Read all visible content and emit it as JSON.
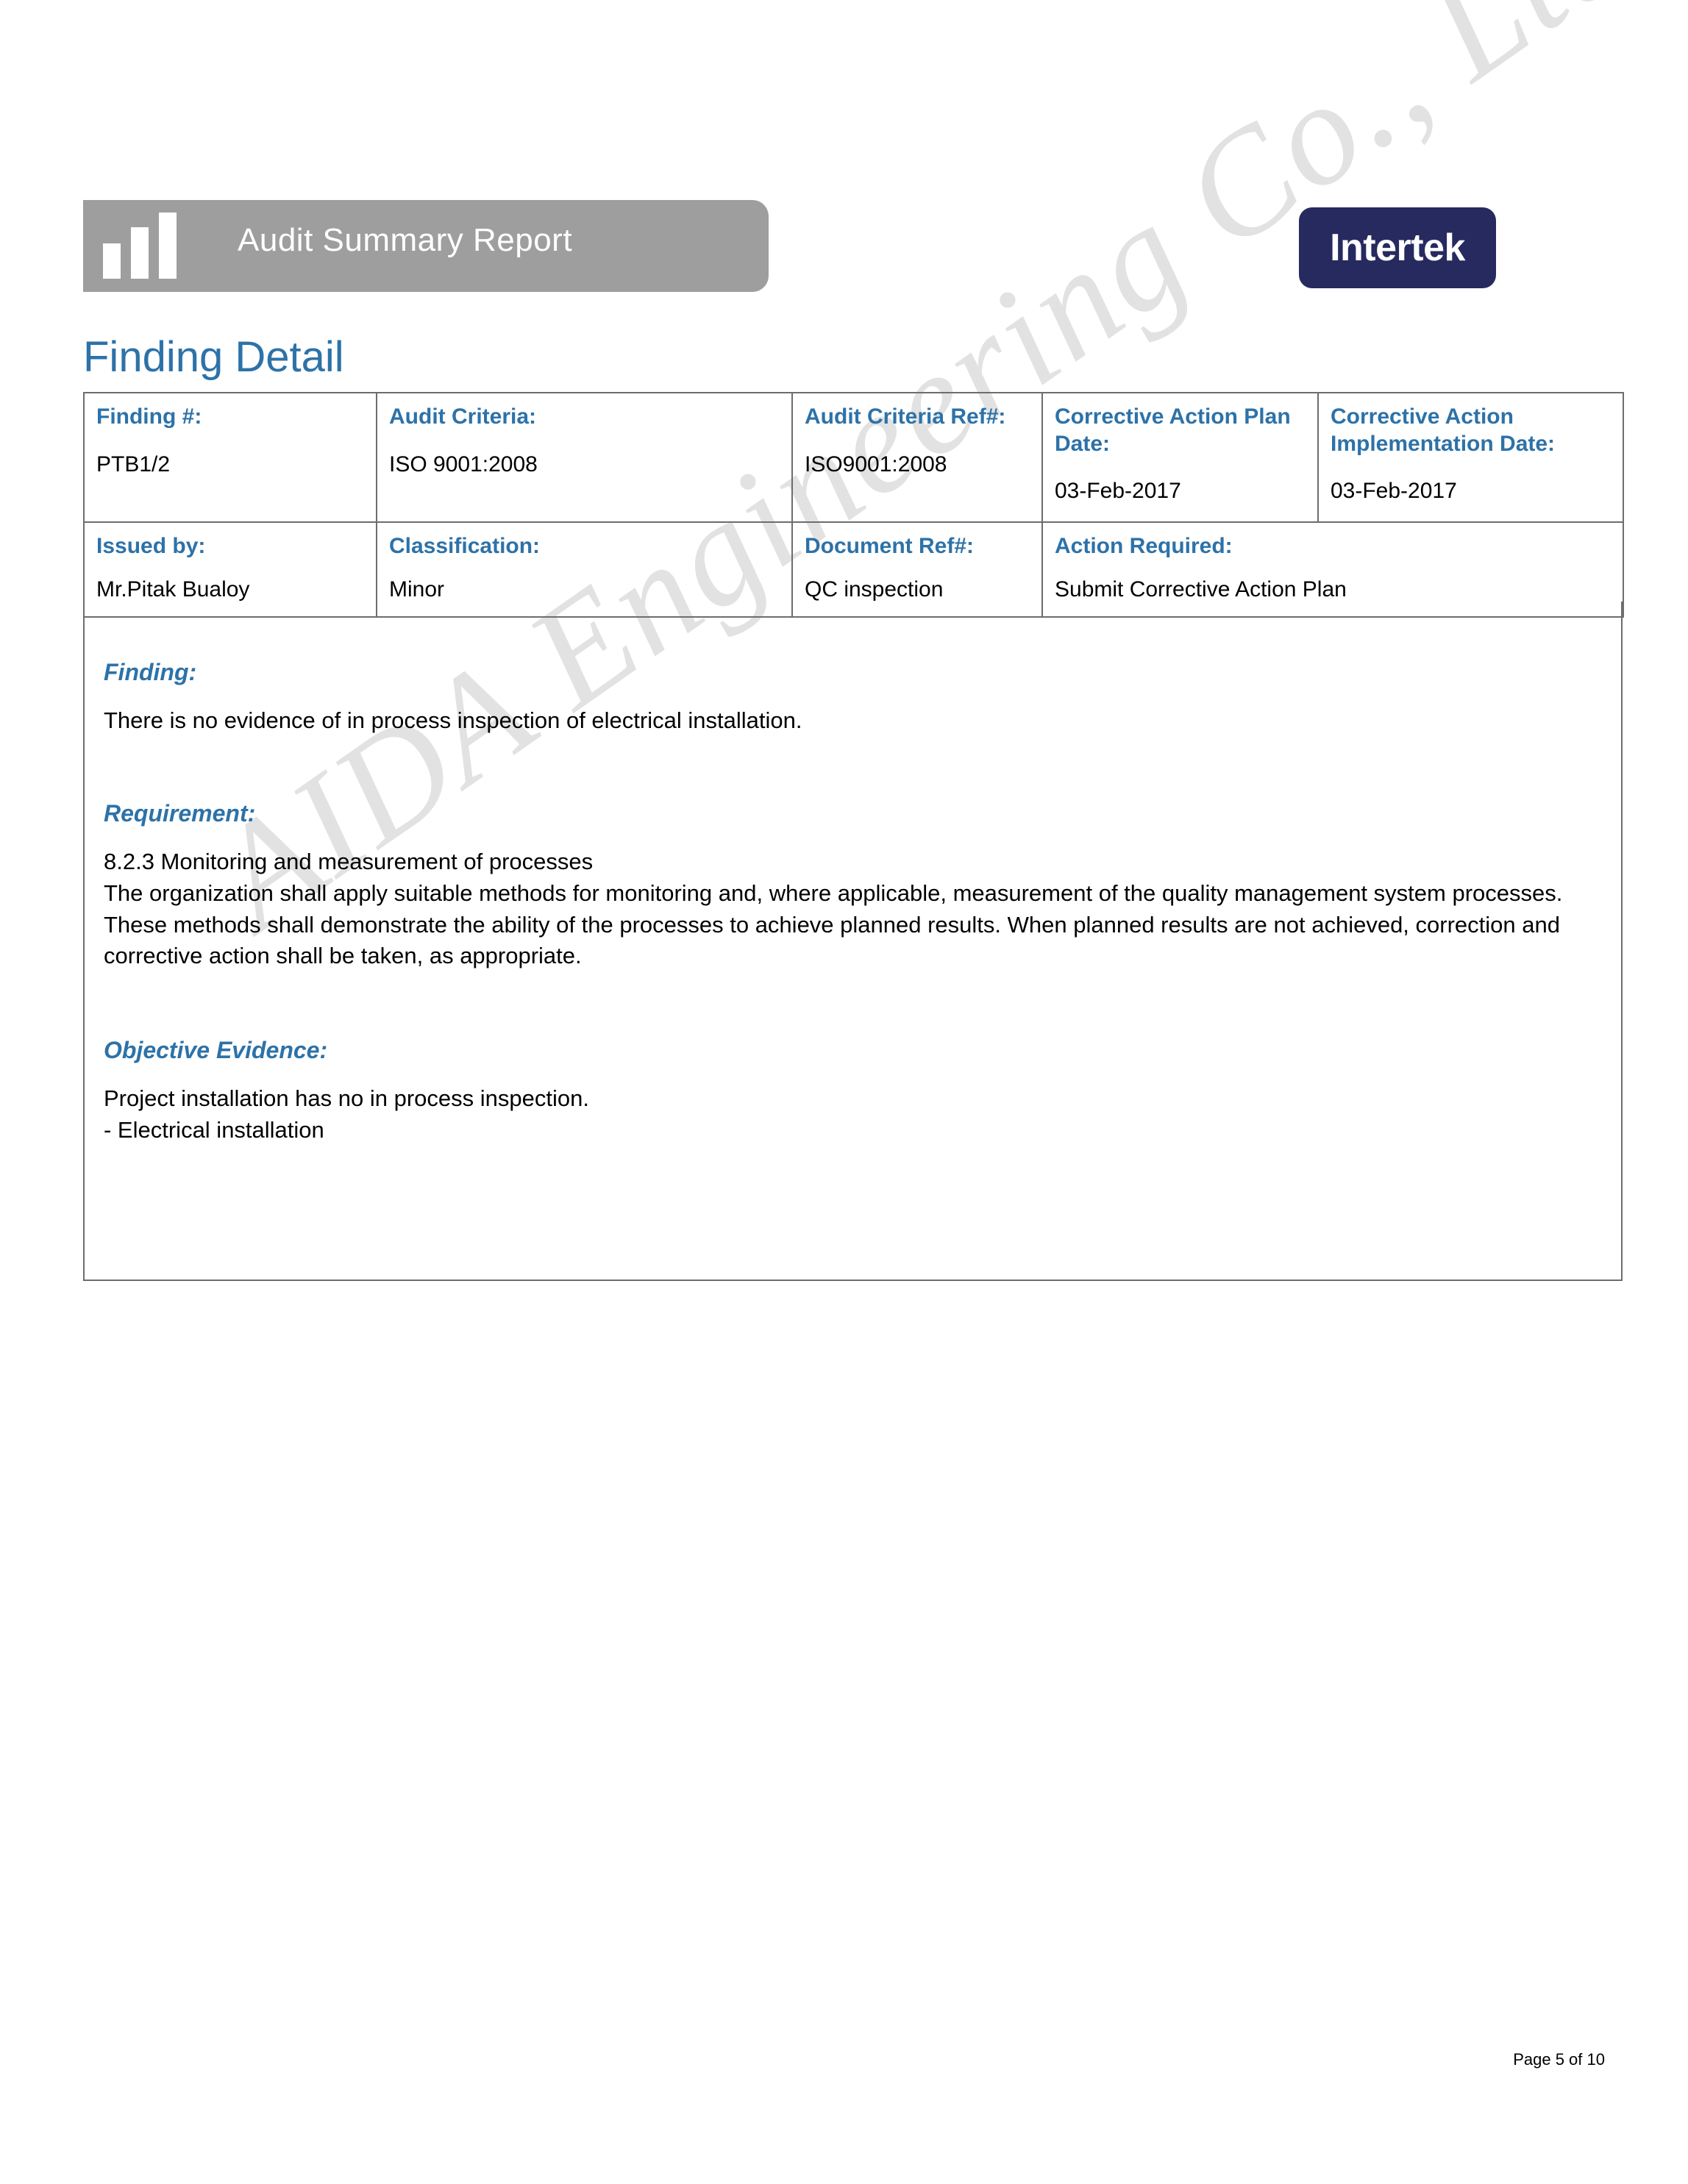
{
  "document": {
    "banner_title": "Audit Summary Report",
    "logo_text": "Intertek",
    "page_heading": "Finding Detail",
    "watermark": "AIDA Engineering Co., Ltd",
    "footer": "Page 5 of 10"
  },
  "colors": {
    "heading_blue": "#2d72a8",
    "banner_gray": "#9e9e9e",
    "logo_navy": "#262a5e",
    "border_gray": "#6d6d6d",
    "watermark_gray": "#e2e2e2"
  },
  "table": {
    "row1": [
      {
        "label": "Finding #:",
        "value": "PTB1/2"
      },
      {
        "label": "Audit Criteria:",
        "value": "ISO 9001:2008"
      },
      {
        "label": "Audit Criteria Ref#:",
        "value": "ISO9001:2008"
      },
      {
        "label": "Corrective Action Plan Date:",
        "value": "03-Feb-2017"
      },
      {
        "label": "Corrective Action Implementation Date:",
        "value": "03-Feb-2017"
      }
    ],
    "row2": [
      {
        "label": "Issued by:",
        "value": "Mr.Pitak Bualoy"
      },
      {
        "label": "Classification:",
        "value": "Minor"
      },
      {
        "label": "Document Ref#:",
        "value": "QC inspection"
      },
      {
        "label": "Action Required:",
        "value": "Submit Corrective Action Plan"
      }
    ]
  },
  "sections": {
    "finding": {
      "title": "Finding:",
      "body": "There is no evidence of in process inspection of electrical installation."
    },
    "requirement": {
      "title": "Requirement:",
      "body": "8.2.3 Monitoring and measurement of processes\nThe organization shall apply suitable methods for monitoring and, where applicable, measurement of the quality management system processes. These methods shall demonstrate the ability of the processes to achieve planned results. When planned results are not achieved, correction and corrective action shall be taken, as appropriate."
    },
    "objective_evidence": {
      "title": "Objective Evidence:",
      "body": "Project installation has no in process inspection.\n- Electrical installation"
    }
  }
}
